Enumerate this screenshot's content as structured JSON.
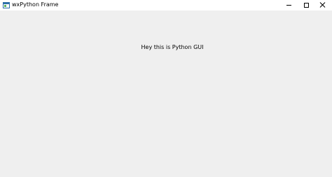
{
  "window": {
    "title": "wxPython Frame",
    "icon": "app-window-icon",
    "controls": {
      "minimize": "minimize-icon",
      "maximize": "maximize-icon",
      "close": "close-icon"
    }
  },
  "content": {
    "label": "Hey this is Python GUI"
  },
  "colors": {
    "titlebar": "#ffffff",
    "client_background": "#efefef",
    "text": "#000000"
  }
}
